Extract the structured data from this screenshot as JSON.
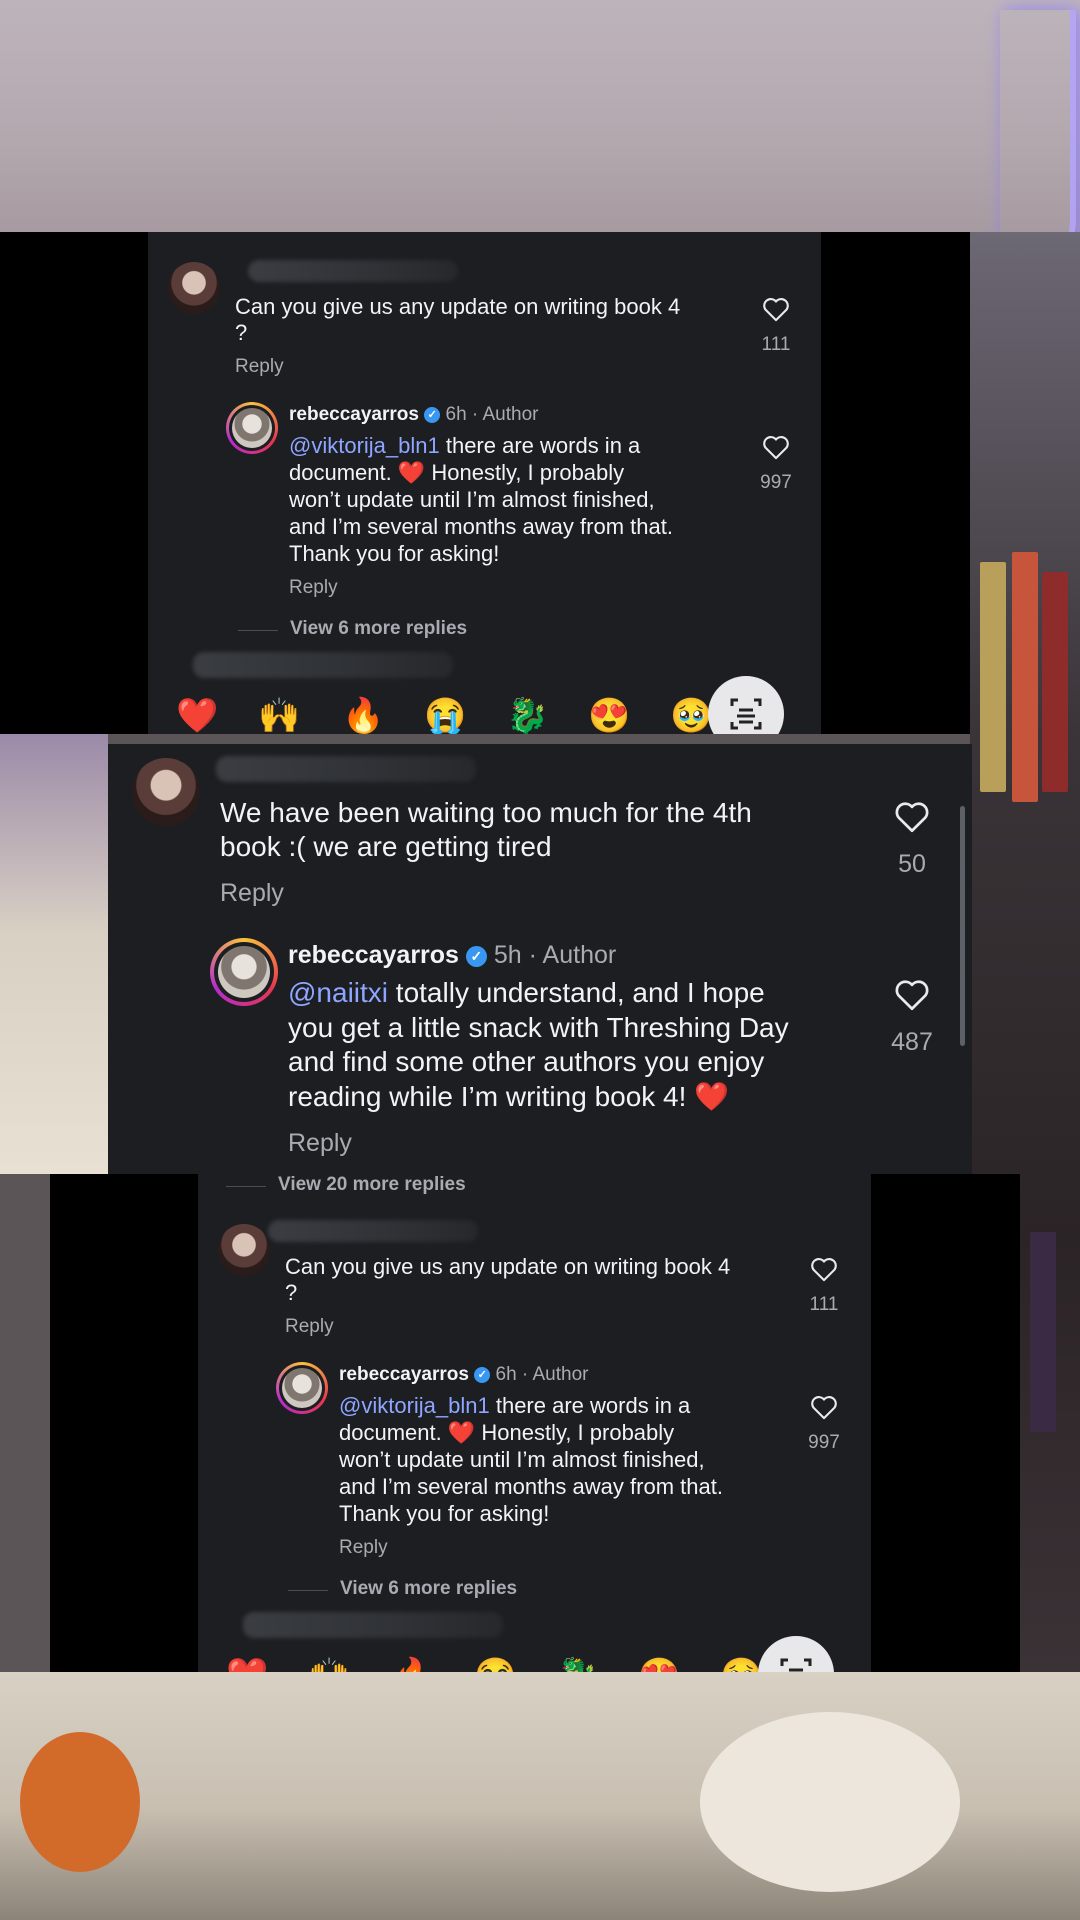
{
  "screenshots": [
    {
      "comment": {
        "text_line1": "Can you give us any update on writing book 4",
        "text_line2": "?",
        "like_count": "111",
        "reply_label": "Reply"
      },
      "reply": {
        "username": "rebeccayarros",
        "time": "6h",
        "separator": "·",
        "author_tag": "Author",
        "mention": "@viktorija_bln1",
        "line1": " there are words in a",
        "line2a": "document. ",
        "heart_emoji": "❤️",
        "line2b": " Honestly, I probably",
        "line3": "won’t update until I’m almost finished,",
        "line4": "and I’m several months away from that.",
        "line5": "Thank you for asking!",
        "like_count": "997",
        "reply_label": "Reply"
      },
      "view_more": "View 6 more replies"
    },
    {
      "comment": {
        "text_line1": "We have been waiting too much for the 4th",
        "text_line2": "book :( we are getting tired",
        "like_count": "50",
        "reply_label": "Reply"
      },
      "reply": {
        "username": "rebeccayarros",
        "time": "5h",
        "separator": "·",
        "author_tag": "Author",
        "mention": "@naiitxi",
        "line1": " totally understand, and I hope",
        "line2": "you get a little snack with Threshing Day",
        "line3": "and find some other authors you enjoy",
        "line4a": "reading while I’m writing book 4! ",
        "heart_emoji": "❤️",
        "like_count": "487",
        "reply_label": "Reply"
      },
      "view_more": "View 20 more replies"
    },
    {
      "comment": {
        "text_line1": "Can you give us any update on writing book 4",
        "text_line2": "?",
        "like_count": "111",
        "reply_label": "Reply"
      },
      "reply": {
        "username": "rebeccayarros",
        "time": "6h",
        "separator": "·",
        "author_tag": "Author",
        "mention": "@viktorija_bln1",
        "line1": " there are words in a",
        "line2a": "document. ",
        "heart_emoji": "❤️",
        "line2b": " Honestly, I probably",
        "line3": "won’t update until I’m almost finished,",
        "line4": "and I’m several months away from that.",
        "line5": "Thank you for asking!",
        "like_count": "997",
        "reply_label": "Reply"
      },
      "view_more": "View 6 more replies"
    }
  ],
  "emoji_bar": [
    "❤️",
    "🙌",
    "🔥",
    "😭",
    "🐉",
    "😍",
    "🥹"
  ],
  "icons": {
    "like": "heart-outline-icon",
    "verified": "verified-badge-icon",
    "scan": "text-scan-icon"
  },
  "colors": {
    "panel_bg": "#1c1e22",
    "mention": "#8ea6ff",
    "verified": "#3897f0"
  }
}
